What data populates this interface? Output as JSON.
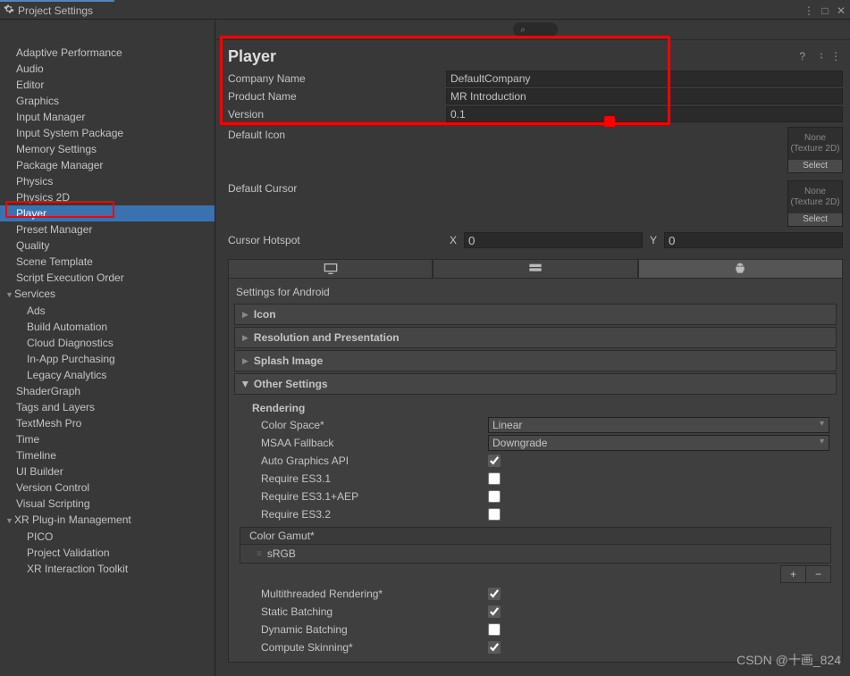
{
  "window": {
    "title": "Project Settings"
  },
  "sidebar": {
    "items": [
      {
        "label": "Adaptive Performance"
      },
      {
        "label": "Audio"
      },
      {
        "label": "Editor"
      },
      {
        "label": "Graphics"
      },
      {
        "label": "Input Manager"
      },
      {
        "label": "Input System Package"
      },
      {
        "label": "Memory Settings"
      },
      {
        "label": "Package Manager"
      },
      {
        "label": "Physics"
      },
      {
        "label": "Physics 2D"
      },
      {
        "label": "Player",
        "selected": true
      },
      {
        "label": "Preset Manager"
      },
      {
        "label": "Quality"
      },
      {
        "label": "Scene Template"
      },
      {
        "label": "Script Execution Order"
      },
      {
        "label": "Services",
        "expanded": true,
        "children": [
          {
            "label": "Ads"
          },
          {
            "label": "Build Automation"
          },
          {
            "label": "Cloud Diagnostics"
          },
          {
            "label": "In-App Purchasing"
          },
          {
            "label": "Legacy Analytics"
          }
        ]
      },
      {
        "label": "ShaderGraph"
      },
      {
        "label": "Tags and Layers"
      },
      {
        "label": "TextMesh Pro"
      },
      {
        "label": "Time"
      },
      {
        "label": "Timeline"
      },
      {
        "label": "UI Builder"
      },
      {
        "label": "Version Control"
      },
      {
        "label": "Visual Scripting"
      },
      {
        "label": "XR Plug-in Management",
        "expanded": true,
        "children": [
          {
            "label": "PICO"
          },
          {
            "label": "Project Validation"
          },
          {
            "label": "XR Interaction Toolkit"
          }
        ]
      }
    ]
  },
  "player": {
    "title": "Player",
    "company_label": "Company Name",
    "company_value": "DefaultCompany",
    "product_label": "Product Name",
    "product_value": "MR Introduction",
    "version_label": "Version",
    "version_value": "0.1",
    "default_icon_label": "Default Icon",
    "default_cursor_label": "Default Cursor",
    "obj_none": "None",
    "obj_type": "(Texture 2D)",
    "obj_select": "Select",
    "cursor_hotspot_label": "Cursor Hotspot",
    "hotspot_x": "0",
    "hotspot_y": "0",
    "settings_for": "Settings for Android",
    "foldouts": {
      "icon": "Icon",
      "resolution": "Resolution and Presentation",
      "splash": "Splash Image",
      "other": "Other Settings"
    },
    "rendering": {
      "heading": "Rendering",
      "color_space_label": "Color Space*",
      "color_space_value": "Linear",
      "msaa_label": "MSAA Fallback",
      "msaa_value": "Downgrade",
      "auto_gapi_label": "Auto Graphics API",
      "auto_gapi_checked": true,
      "es31_label": "Require ES3.1",
      "es31_checked": false,
      "es31aep_label": "Require ES3.1+AEP",
      "es31aep_checked": false,
      "es32_label": "Require ES3.2",
      "es32_checked": false,
      "color_gamut_label": "Color Gamut*",
      "color_gamut_item": "sRGB",
      "mt_render_label": "Multithreaded Rendering*",
      "mt_render_checked": true,
      "static_batch_label": "Static Batching",
      "static_batch_checked": true,
      "dyn_batch_label": "Dynamic Batching",
      "dyn_batch_checked": false,
      "compute_skin_label": "Compute Skinning*",
      "compute_skin_checked": true
    }
  },
  "watermark": "CSDN @十画_824"
}
